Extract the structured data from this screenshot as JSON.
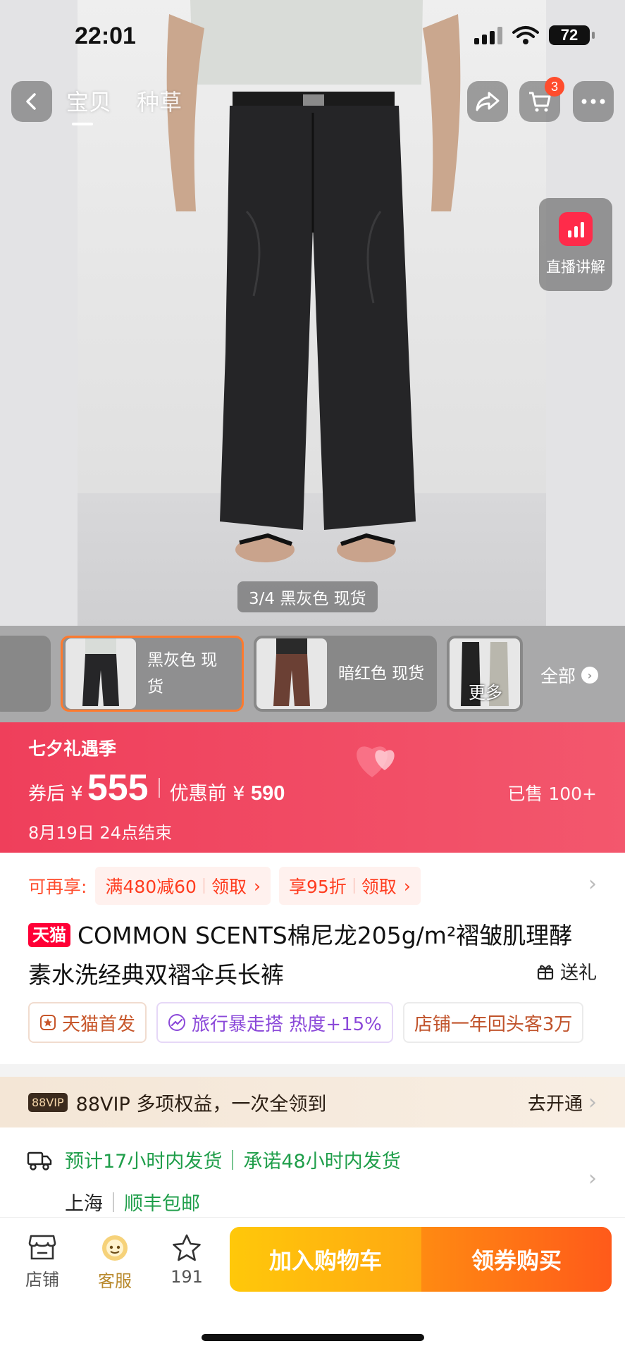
{
  "status": {
    "time": "22:01",
    "battery": "72"
  },
  "nav": {
    "tab_product": "宝贝",
    "tab_seed": "种草",
    "cart_count": "3"
  },
  "live": {
    "label": "直播讲解"
  },
  "gallery": {
    "counter": "3/4 黑灰色 现货"
  },
  "variants": {
    "items": [
      {
        "label": "黑灰色 现货"
      },
      {
        "label": "暗红色 现货"
      }
    ],
    "more_thumb_label": "更多",
    "all_label": "全部"
  },
  "price": {
    "festival": "七夕礼遇季",
    "after_coupon_label": "券后",
    "currency": "¥",
    "after_coupon_value": "555",
    "before_label": "优惠前",
    "before_value": "590",
    "sold": "已售 100+",
    "deadline": "8月19日 24点结束"
  },
  "coupons": {
    "label": "可再享:",
    "items": [
      {
        "text": "满480减60",
        "action": "领取"
      },
      {
        "text": "享95折",
        "action": "领取"
      }
    ]
  },
  "product": {
    "badge": "天猫",
    "title": "COMMON SCENTS棉尼龙205g/m²褶皱肌理酵素水洗经典双褶伞兵长裤",
    "gift": "送礼"
  },
  "tags": [
    {
      "text": "天猫首发"
    },
    {
      "text": "旅行暴走搭 热度+15%"
    },
    {
      "text": "店铺一年回头客3万"
    }
  ],
  "vip": {
    "badge": "88VIP",
    "text": "88VIP 多项权益，一次全领到",
    "action": "去开通"
  },
  "shipping": {
    "estimate": "预计17小时内发货",
    "promise": "承诺48小时内发货",
    "city": "上海",
    "carrier": "顺丰包邮"
  },
  "bottom": {
    "store": "店铺",
    "service": "客服",
    "fav_count": "191",
    "add_cart": "加入购物车",
    "buy": "领券购买"
  },
  "colors": {
    "accent_red": "#ef3f5b",
    "cart_yellow": "#ffc80a",
    "buy_orange": "#ff5a1a",
    "ship_green": "#1f9e4a"
  }
}
